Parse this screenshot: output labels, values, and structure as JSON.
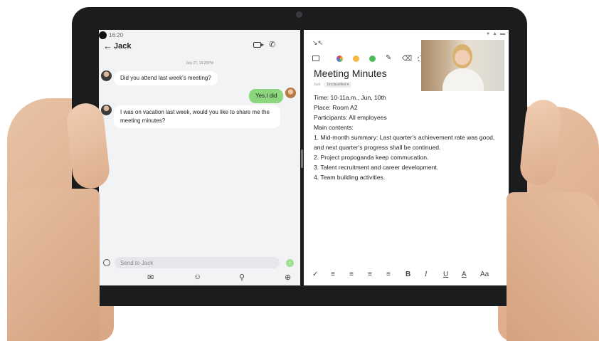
{
  "status_bar": {
    "time": "16:20"
  },
  "chat": {
    "contact_name": "Jack",
    "date_stamp": "July 27, 16:20PM",
    "messages": [
      {
        "from": "contact",
        "text": "Did you attend last week's meeting?"
      },
      {
        "from": "me",
        "text": "Yes,I did"
      },
      {
        "from": "contact",
        "text_line1": "I was on vacation last week, would you like to share me the",
        "text_line2": "meeting minutes?"
      }
    ],
    "input_placeholder": "Send to Jack"
  },
  "icons": {
    "back": "arrow-left-icon",
    "video_call": "video-camera-icon",
    "voice_call": "phone-icon",
    "mail": "mail-icon",
    "emoji": "emoji-icon",
    "location": "location-pin-icon",
    "add": "plus-circle-icon"
  },
  "notes": {
    "title": "Meeting Minutes",
    "meta_time": "Just",
    "meta_category": "Unclassified ▾",
    "lines": [
      "Time: 10-11a.m., Jun, 10th",
      "Place: Room A2",
      "Participants: All employees",
      "Main contents:",
      "1. Mid-month summary: Last quarter's achievement rate was good,",
      "and next quarter's progress shall be continued.",
      "2. Project propoganda keep commucation.",
      "3. Talent recruitment and career development.",
      "4. Team building activities."
    ],
    "pen_colors": [
      "#f5b942",
      "#4cba5b"
    ],
    "format_labels": {
      "bold": "B",
      "italic": "I",
      "underline": "U",
      "font_color": "A",
      "font_size": "Aa"
    }
  },
  "colors": {
    "sent_bubble": "#8cd67d",
    "received_bubble": "#ffffff",
    "send_button": "#9fe08f"
  }
}
